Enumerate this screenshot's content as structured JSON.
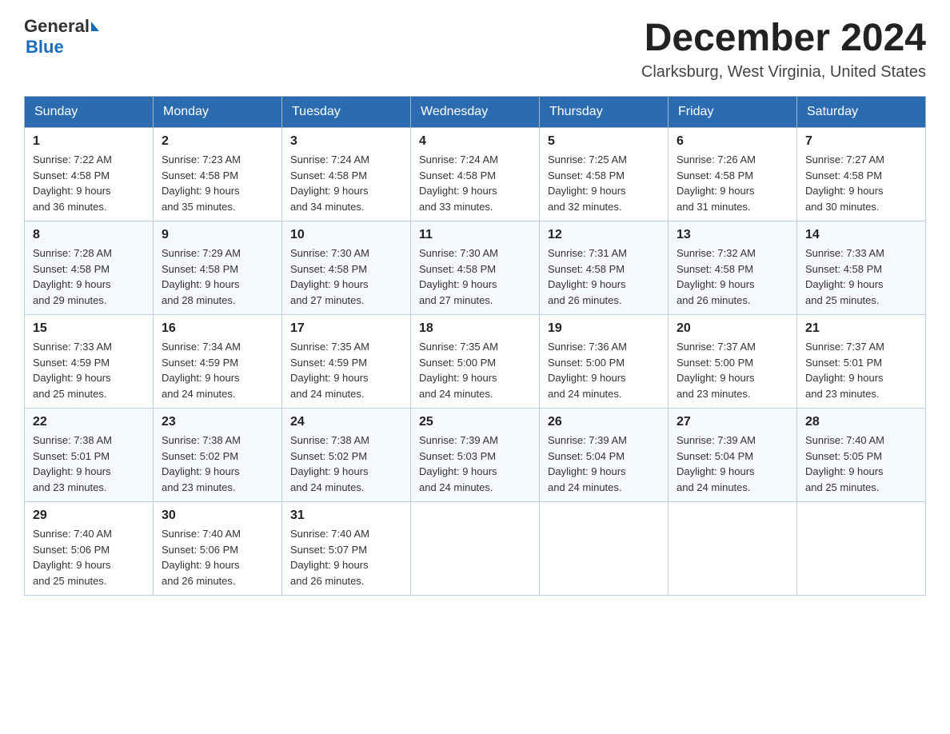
{
  "header": {
    "logo_general": "General",
    "logo_blue": "Blue",
    "month_title": "December 2024",
    "location": "Clarksburg, West Virginia, United States"
  },
  "days_of_week": [
    "Sunday",
    "Monday",
    "Tuesday",
    "Wednesday",
    "Thursday",
    "Friday",
    "Saturday"
  ],
  "weeks": [
    [
      {
        "day": "1",
        "sunrise": "7:22 AM",
        "sunset": "4:58 PM",
        "daylight": "9 hours and 36 minutes."
      },
      {
        "day": "2",
        "sunrise": "7:23 AM",
        "sunset": "4:58 PM",
        "daylight": "9 hours and 35 minutes."
      },
      {
        "day": "3",
        "sunrise": "7:24 AM",
        "sunset": "4:58 PM",
        "daylight": "9 hours and 34 minutes."
      },
      {
        "day": "4",
        "sunrise": "7:24 AM",
        "sunset": "4:58 PM",
        "daylight": "9 hours and 33 minutes."
      },
      {
        "day": "5",
        "sunrise": "7:25 AM",
        "sunset": "4:58 PM",
        "daylight": "9 hours and 32 minutes."
      },
      {
        "day": "6",
        "sunrise": "7:26 AM",
        "sunset": "4:58 PM",
        "daylight": "9 hours and 31 minutes."
      },
      {
        "day": "7",
        "sunrise": "7:27 AM",
        "sunset": "4:58 PM",
        "daylight": "9 hours and 30 minutes."
      }
    ],
    [
      {
        "day": "8",
        "sunrise": "7:28 AM",
        "sunset": "4:58 PM",
        "daylight": "9 hours and 29 minutes."
      },
      {
        "day": "9",
        "sunrise": "7:29 AM",
        "sunset": "4:58 PM",
        "daylight": "9 hours and 28 minutes."
      },
      {
        "day": "10",
        "sunrise": "7:30 AM",
        "sunset": "4:58 PM",
        "daylight": "9 hours and 27 minutes."
      },
      {
        "day": "11",
        "sunrise": "7:30 AM",
        "sunset": "4:58 PM",
        "daylight": "9 hours and 27 minutes."
      },
      {
        "day": "12",
        "sunrise": "7:31 AM",
        "sunset": "4:58 PM",
        "daylight": "9 hours and 26 minutes."
      },
      {
        "day": "13",
        "sunrise": "7:32 AM",
        "sunset": "4:58 PM",
        "daylight": "9 hours and 26 minutes."
      },
      {
        "day": "14",
        "sunrise": "7:33 AM",
        "sunset": "4:58 PM",
        "daylight": "9 hours and 25 minutes."
      }
    ],
    [
      {
        "day": "15",
        "sunrise": "7:33 AM",
        "sunset": "4:59 PM",
        "daylight": "9 hours and 25 minutes."
      },
      {
        "day": "16",
        "sunrise": "7:34 AM",
        "sunset": "4:59 PM",
        "daylight": "9 hours and 24 minutes."
      },
      {
        "day": "17",
        "sunrise": "7:35 AM",
        "sunset": "4:59 PM",
        "daylight": "9 hours and 24 minutes."
      },
      {
        "day": "18",
        "sunrise": "7:35 AM",
        "sunset": "5:00 PM",
        "daylight": "9 hours and 24 minutes."
      },
      {
        "day": "19",
        "sunrise": "7:36 AM",
        "sunset": "5:00 PM",
        "daylight": "9 hours and 24 minutes."
      },
      {
        "day": "20",
        "sunrise": "7:37 AM",
        "sunset": "5:00 PM",
        "daylight": "9 hours and 23 minutes."
      },
      {
        "day": "21",
        "sunrise": "7:37 AM",
        "sunset": "5:01 PM",
        "daylight": "9 hours and 23 minutes."
      }
    ],
    [
      {
        "day": "22",
        "sunrise": "7:38 AM",
        "sunset": "5:01 PM",
        "daylight": "9 hours and 23 minutes."
      },
      {
        "day": "23",
        "sunrise": "7:38 AM",
        "sunset": "5:02 PM",
        "daylight": "9 hours and 23 minutes."
      },
      {
        "day": "24",
        "sunrise": "7:38 AM",
        "sunset": "5:02 PM",
        "daylight": "9 hours and 24 minutes."
      },
      {
        "day": "25",
        "sunrise": "7:39 AM",
        "sunset": "5:03 PM",
        "daylight": "9 hours and 24 minutes."
      },
      {
        "day": "26",
        "sunrise": "7:39 AM",
        "sunset": "5:04 PM",
        "daylight": "9 hours and 24 minutes."
      },
      {
        "day": "27",
        "sunrise": "7:39 AM",
        "sunset": "5:04 PM",
        "daylight": "9 hours and 24 minutes."
      },
      {
        "day": "28",
        "sunrise": "7:40 AM",
        "sunset": "5:05 PM",
        "daylight": "9 hours and 25 minutes."
      }
    ],
    [
      {
        "day": "29",
        "sunrise": "7:40 AM",
        "sunset": "5:06 PM",
        "daylight": "9 hours and 25 minutes."
      },
      {
        "day": "30",
        "sunrise": "7:40 AM",
        "sunset": "5:06 PM",
        "daylight": "9 hours and 26 minutes."
      },
      {
        "day": "31",
        "sunrise": "7:40 AM",
        "sunset": "5:07 PM",
        "daylight": "9 hours and 26 minutes."
      },
      null,
      null,
      null,
      null
    ]
  ],
  "labels": {
    "sunrise": "Sunrise:",
    "sunset": "Sunset:",
    "daylight": "Daylight:"
  }
}
